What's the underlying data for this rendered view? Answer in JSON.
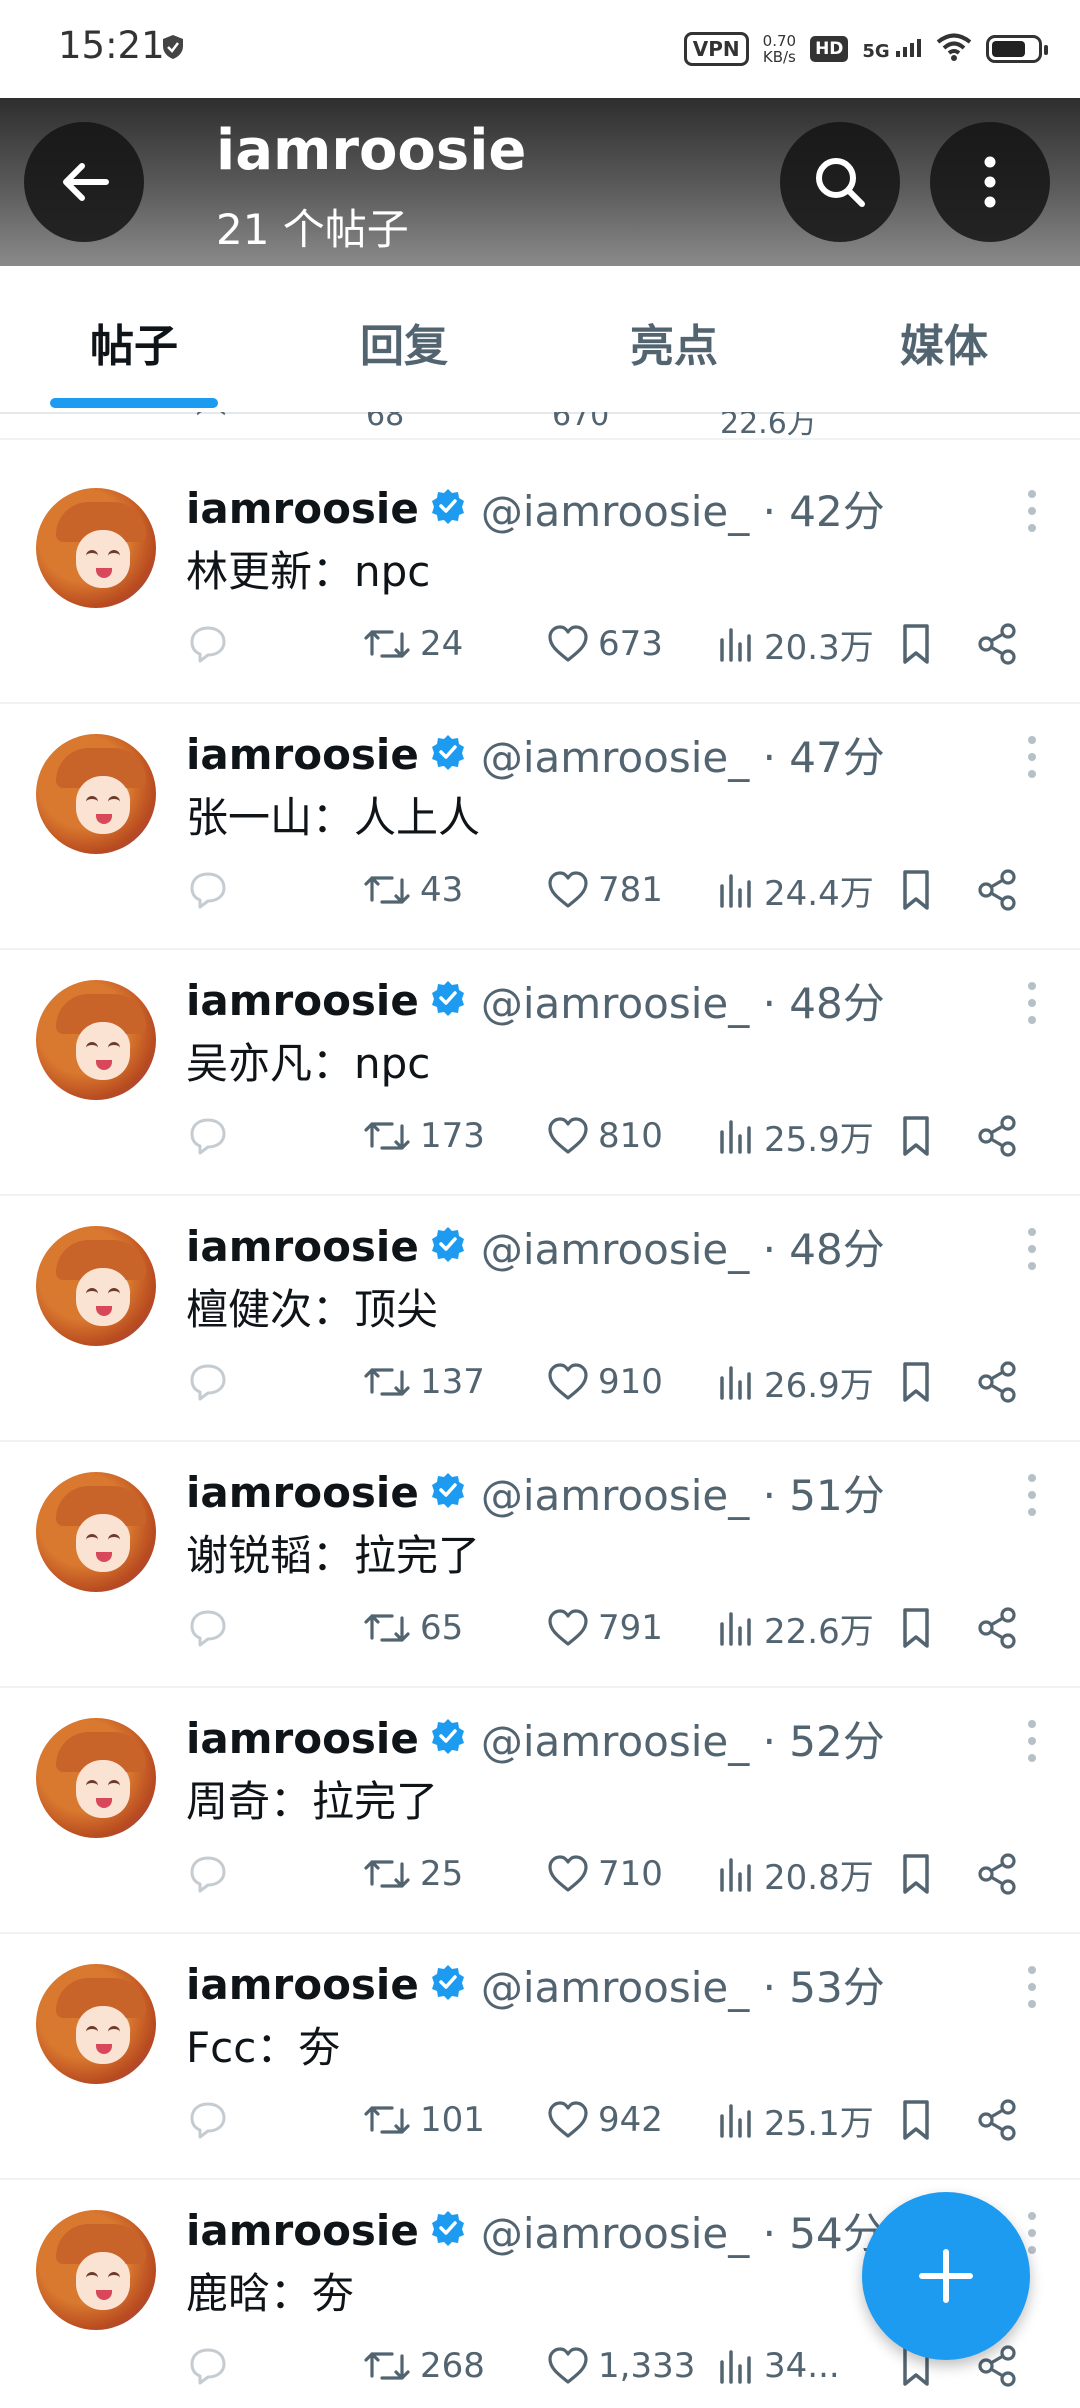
{
  "status_bar": {
    "time": "15:21",
    "vpn": "VPN",
    "speed_value": "0.70",
    "speed_unit": "KB/s",
    "hd": "HD",
    "network": "5G"
  },
  "header": {
    "title": "iamroosie",
    "subtitle": "21 个帖子"
  },
  "tabs": [
    {
      "label": "帖子",
      "active": true
    },
    {
      "label": "回复",
      "active": false
    },
    {
      "label": "亮点",
      "active": false
    },
    {
      "label": "媒体",
      "active": false
    }
  ],
  "partial_post": {
    "retweets": "68",
    "likes": "670",
    "views": "22.6万"
  },
  "posts": [
    {
      "name": "iamroosie",
      "handle": "@iamroosie_ · 42分",
      "text": "林更新：npc",
      "retweets": "24",
      "likes": "673",
      "views": "20.3万"
    },
    {
      "name": "iamroosie",
      "handle": "@iamroosie_ · 47分",
      "text": "张一山：人上人",
      "retweets": "43",
      "likes": "781",
      "views": "24.4万"
    },
    {
      "name": "iamroosie",
      "handle": "@iamroosie_ · 48分",
      "text": "吴亦凡：npc",
      "retweets": "173",
      "likes": "810",
      "views": "25.9万"
    },
    {
      "name": "iamroosie",
      "handle": "@iamroosie_ · 48分",
      "text": "檀健次：顶尖",
      "retweets": "137",
      "likes": "910",
      "views": "26.9万"
    },
    {
      "name": "iamroosie",
      "handle": "@iamroosie_ · 51分",
      "text": "谢锐韬：拉完了",
      "retweets": "65",
      "likes": "791",
      "views": "22.6万"
    },
    {
      "name": "iamroosie",
      "handle": "@iamroosie_ · 52分",
      "text": "周奇：拉完了",
      "retweets": "25",
      "likes": "710",
      "views": "20.8万"
    },
    {
      "name": "iamroosie",
      "handle": "@iamroosie_ · 53分",
      "text": "Fcc：夯",
      "retweets": "101",
      "likes": "942",
      "views": "25.1万"
    },
    {
      "name": "iamroosie",
      "handle": "@iamroosie_ · 54分",
      "text": "鹿晗：夯",
      "retweets": "268",
      "likes": "1,333",
      "views": "34..."
    }
  ],
  "colors": {
    "accent": "#1d9bf0",
    "text_primary": "#0f1419",
    "text_secondary": "#536471"
  },
  "icons": {
    "back": "arrow-left-icon",
    "search": "search-icon",
    "more": "more-vertical-icon",
    "reply": "reply-icon",
    "retweet": "retweet-icon",
    "like": "heart-icon",
    "views": "views-icon",
    "bookmark": "bookmark-icon",
    "share": "share-icon",
    "compose": "plus-icon"
  }
}
